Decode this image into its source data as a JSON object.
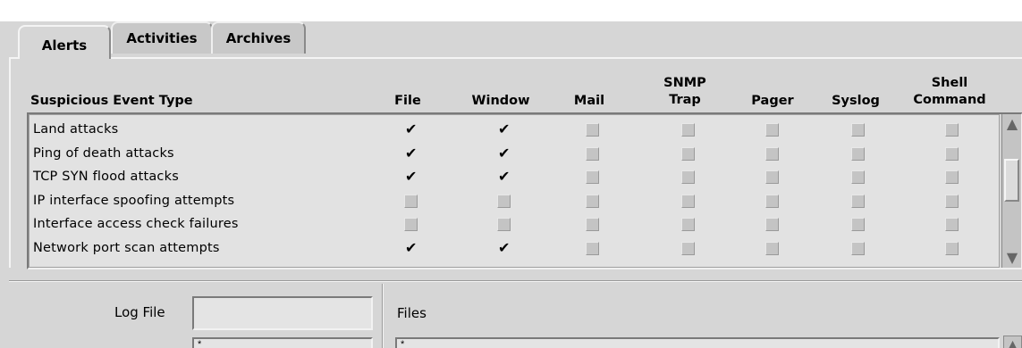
{
  "tabs": [
    {
      "label": "Alerts",
      "active": true
    },
    {
      "label": "Activities",
      "active": false
    },
    {
      "label": "Archives",
      "active": false
    }
  ],
  "columns": {
    "type": "Suspicious Event Type",
    "file": "File",
    "window": "Window",
    "mail": "Mail",
    "snmp_line1": "SNMP",
    "snmp_line2": "Trap",
    "pager": "Pager",
    "syslog": "Syslog",
    "shell_line1": "Shell",
    "shell_line2": "Command"
  },
  "rows": [
    {
      "label": "Land attacks",
      "file": true,
      "window": true,
      "mail": false,
      "snmp": false,
      "pager": false,
      "syslog": false,
      "shell": false
    },
    {
      "label": "Ping of death attacks",
      "file": true,
      "window": true,
      "mail": false,
      "snmp": false,
      "pager": false,
      "syslog": false,
      "shell": false
    },
    {
      "label": "TCP SYN flood attacks",
      "file": true,
      "window": true,
      "mail": false,
      "snmp": false,
      "pager": false,
      "syslog": false,
      "shell": false
    },
    {
      "label": "IP interface spoofing attempts",
      "file": false,
      "window": false,
      "mail": false,
      "snmp": false,
      "pager": false,
      "syslog": false,
      "shell": false
    },
    {
      "label": "Interface access check failures",
      "file": false,
      "window": false,
      "mail": false,
      "snmp": false,
      "pager": false,
      "syslog": false,
      "shell": false
    },
    {
      "label": "Network port scan attempts",
      "file": true,
      "window": true,
      "mail": false,
      "snmp": false,
      "pager": false,
      "syslog": false,
      "shell": false
    }
  ],
  "log_file": {
    "label": "Log File",
    "value": ""
  },
  "files": {
    "label": "Files",
    "first_value": "*"
  },
  "next_field": {
    "value": "*"
  },
  "icons": {
    "check": "checkmark-icon",
    "scroll_up": "arrow-up-icon",
    "scroll_down": "arrow-down-icon"
  }
}
